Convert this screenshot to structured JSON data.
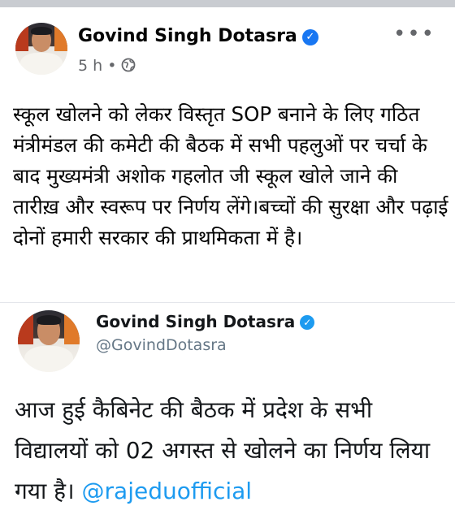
{
  "post": {
    "author": "Govind Singh Dotasra",
    "time": "5 h",
    "separator": "•",
    "text": "स्कूल खोलने को लेकर विस्तृत SOP बनाने के लिए गठित मंत्रीमंडल की कमेटी की बैठक में सभी पहलुओं पर चर्चा के बाद मुख्यमंत्री अशोक गहलोत जी स्कूल खोले जाने की तारीख़ और स्वरूप पर निर्णय लेंगे।बच्चों की सुरक्षा और पढ़ाई दोनों हमारी सरकार की प्राथमिकता में है।",
    "more_label": "•••"
  },
  "quoted": {
    "name": "Govind Singh Dotasra",
    "handle": "@GovindDotasra",
    "text": "आज हुई कैबिनेट की बैठक में प्रदेश के सभी विद्यालयों को 02 अगस्त से खोलने का निर्णय लिया गया है। ",
    "mention": "@rajeduofficial"
  },
  "icons": {
    "verified": "verified-check-icon",
    "privacy": "globe-icon",
    "more": "more-options-icon"
  },
  "colors": {
    "verified_blue": "#1877f2",
    "twitter_verified": "#1d9bf0",
    "mention": "#1d9bf0",
    "meta_gray": "#65676b"
  }
}
